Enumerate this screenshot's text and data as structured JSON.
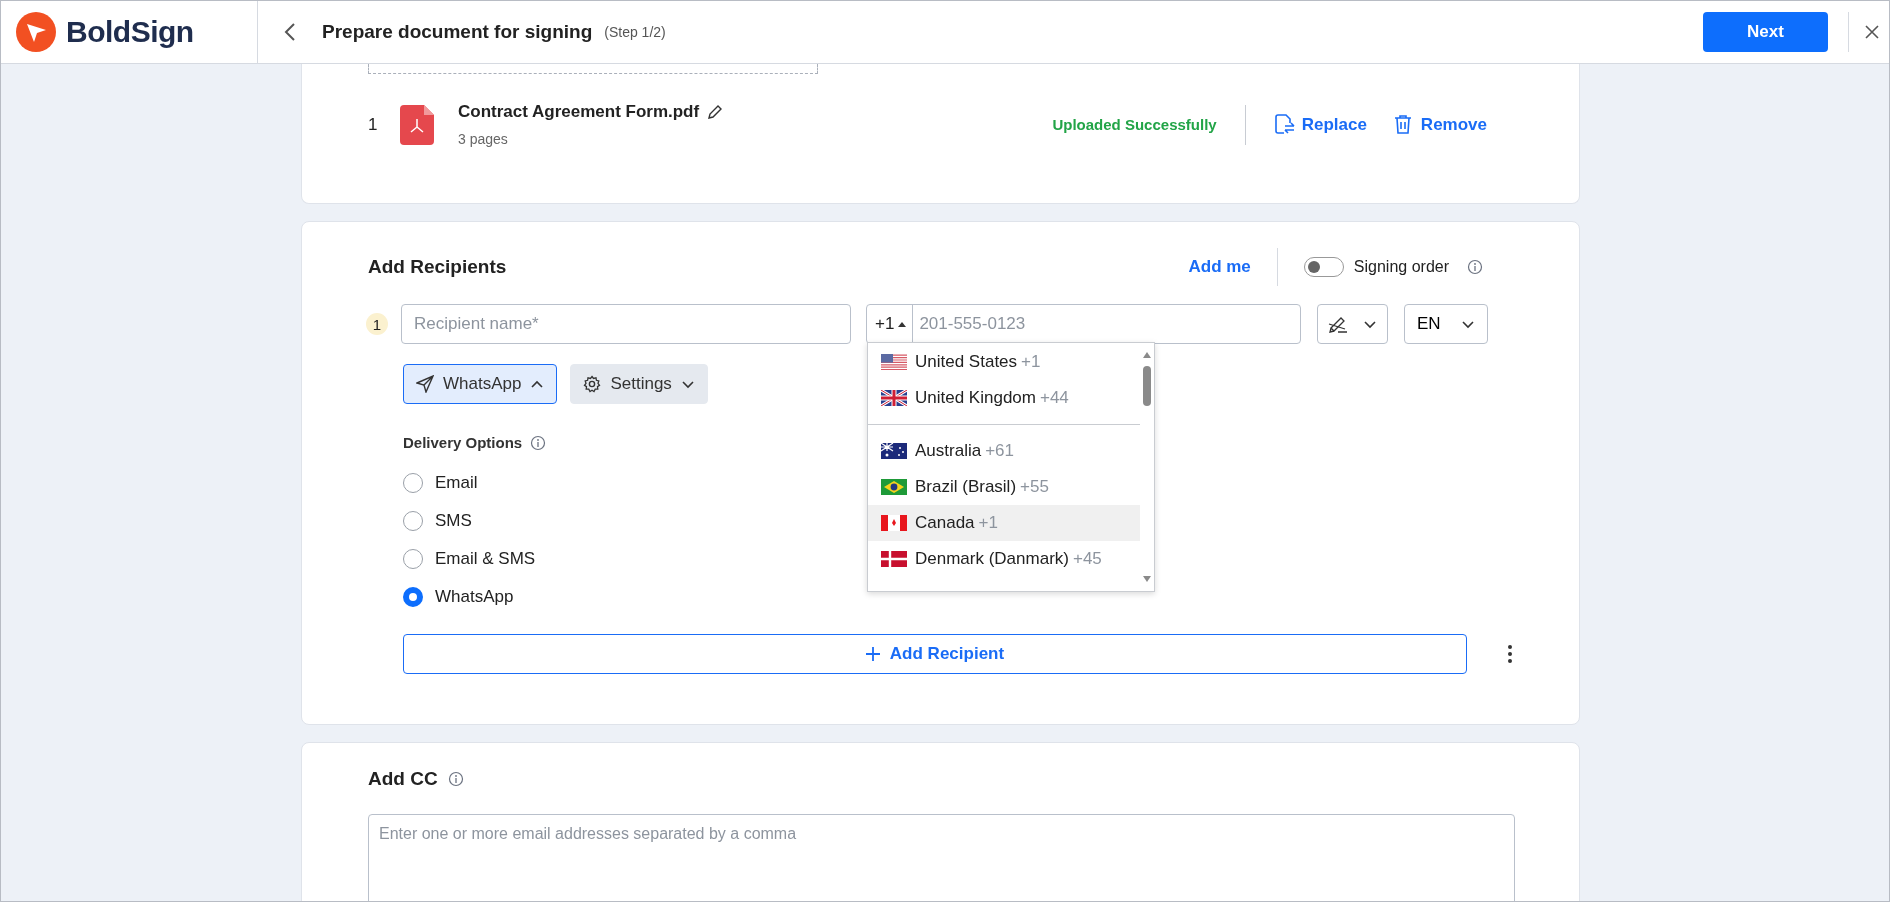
{
  "header": {
    "brand": "BoldSign",
    "title": "Prepare document for signing",
    "step": "(Step 1/2)",
    "next_button": "Next"
  },
  "document": {
    "number": "1",
    "name": "Contract Agreement Form.pdf",
    "pages": "3 pages",
    "status": "Uploaded Successfully",
    "actions": [
      "Replace",
      "Remove"
    ]
  },
  "recipients": {
    "title": "Add Recipients",
    "add_me": "Add me",
    "signing_order": {
      "label": "Signing order",
      "on": false
    },
    "rows": [
      {
        "number": "1",
        "name_placeholder": "Recipient name*",
        "country_code": "+1",
        "phone_placeholder": "201-555-0123",
        "language": "EN",
        "delivery_button": "WhatsApp",
        "delivery_expanded": true,
        "settings_button": "Settings",
        "delivery_label": "Delivery Options",
        "delivery_options": [
          {
            "label": "Email",
            "selected": false
          },
          {
            "label": "SMS",
            "selected": false
          },
          {
            "label": "Email & SMS",
            "selected": false
          },
          {
            "label": "WhatsApp",
            "selected": true
          }
        ],
        "country_dropdown": {
          "preferred": [
            {
              "name": "United States",
              "code": "+1",
              "highlighted": false
            },
            {
              "name": "United Kingdom",
              "code": "+44",
              "highlighted": false
            }
          ],
          "all": [
            {
              "name": "Australia",
              "code": "+61",
              "highlighted": false
            },
            {
              "name": "Brazil (Brasil)",
              "code": "+55",
              "highlighted": false
            },
            {
              "name": "Canada",
              "code": "+1",
              "highlighted": true
            },
            {
              "name": "Denmark (Danmark)",
              "code": "+45",
              "highlighted": false
            }
          ]
        }
      }
    ],
    "add_recipient": "Add Recipient"
  },
  "cc": {
    "title": "Add CC",
    "placeholder": "Enter one or more email addresses separated by a comma"
  }
}
